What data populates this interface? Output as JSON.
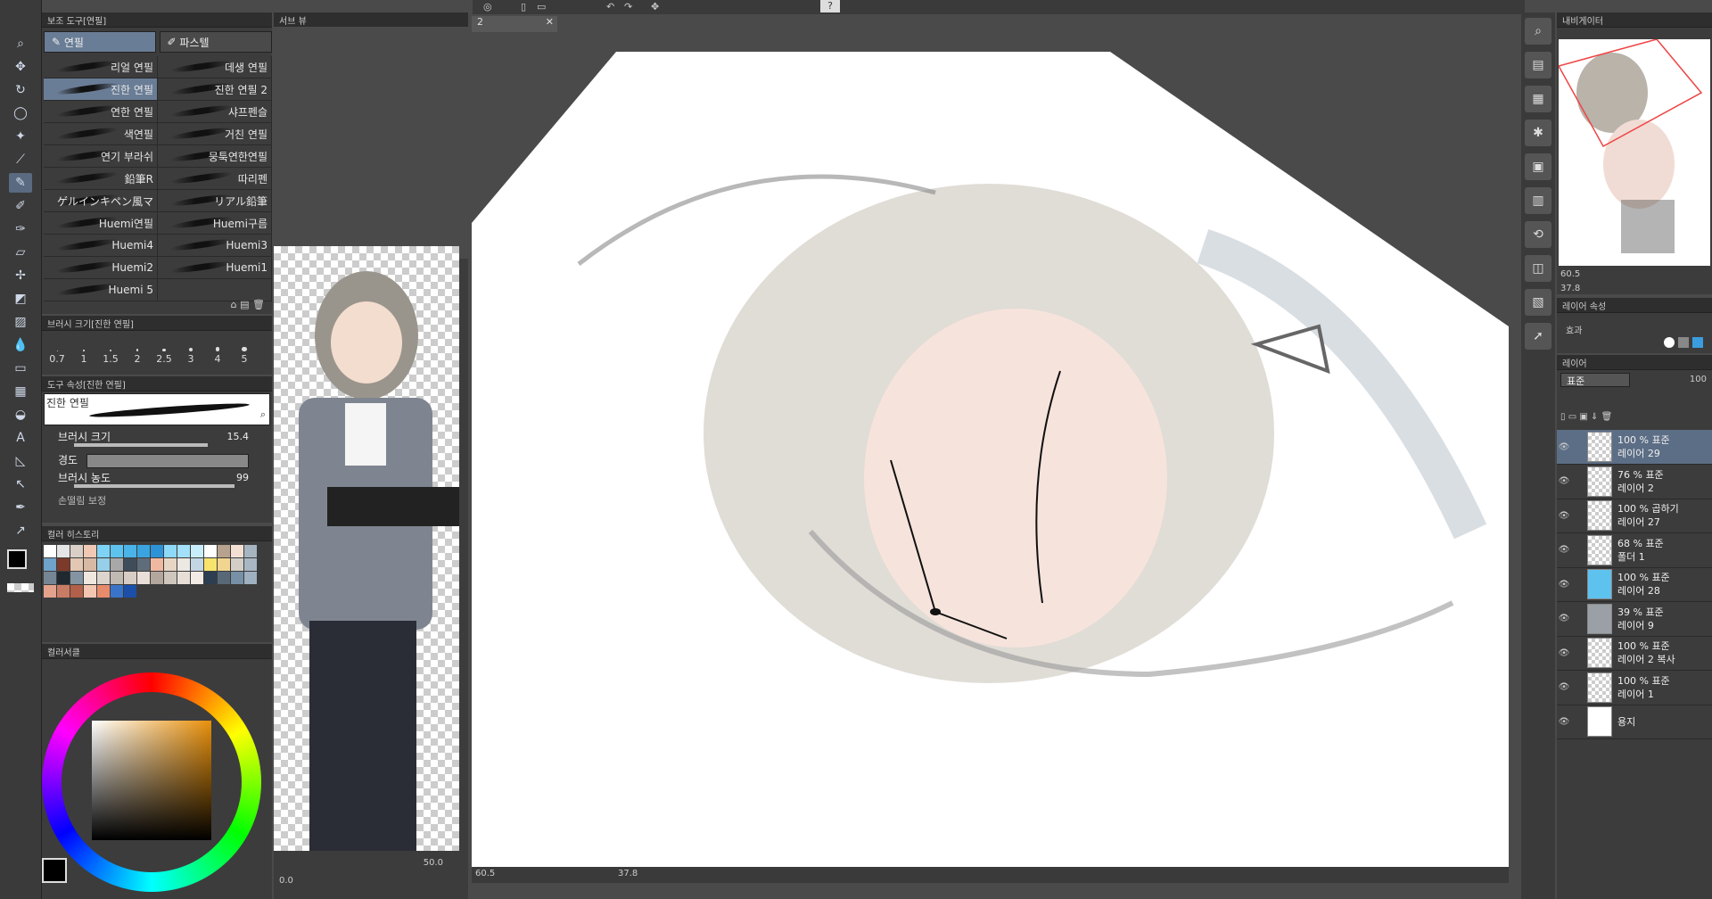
{
  "toolbar": {
    "canvas_tab": "2"
  },
  "subtool_panel": {
    "title": "보조 도구[연필]",
    "tabs": [
      {
        "label": "연필"
      },
      {
        "label": "파스텔"
      }
    ],
    "brushes": [
      [
        "리얼 연필",
        "데생 연필"
      ],
      [
        "진한 연필",
        "진한 연필 2"
      ],
      [
        "연한 연필",
        "샤프펜슬"
      ],
      [
        "색연필",
        "거친 연필"
      ],
      [
        "연기 부라쉬",
        "뭉툭연한연필"
      ],
      [
        "鉛筆R",
        "따리펜"
      ],
      [
        "ゲルインキペン風マ",
        "リアル鉛筆"
      ],
      [
        "Huemi연필",
        "Huemi구름"
      ],
      [
        "Huemi4",
        "Huemi3"
      ],
      [
        "Huemi2",
        "Huemi1"
      ],
      [
        "Huemi 5",
        ""
      ]
    ]
  },
  "brush_size_panel": {
    "title": "브러시 크기[진한 연필]",
    "sizes": [
      "0.7",
      "1",
      "1.5",
      "2",
      "2.5",
      "3",
      "4",
      "5"
    ]
  },
  "tool_property": {
    "title": "도구 속성[진한 연필]",
    "brush_name": "진한 연필",
    "size_label": "브러시 크기",
    "size_value": "15.4",
    "hardness_label": "경도",
    "density_label": "브러시 농도",
    "density_value": "99",
    "cut_label": "손떨림 보정"
  },
  "color_history": {
    "title": "컬러 히스토리"
  },
  "color_circle": {
    "title": "컬러서클"
  },
  "sub_view": {
    "title": "서브 뷰"
  },
  "navigator": {
    "title": "내비게이터",
    "zoom": "60.5",
    "angle": "37.8"
  },
  "layer_property": {
    "title": "레이어 속성",
    "effect_label": "효과"
  },
  "layers_panel": {
    "title": "레이어",
    "blend_mode": "표준",
    "opacity": "100",
    "layers": [
      {
        "mode": "100 % 표준",
        "name": "레이어 29",
        "selected": true
      },
      {
        "mode": "76 % 표준",
        "name": "레이어 2",
        "selected": false
      },
      {
        "mode": "100 % 곱하기",
        "name": "레이어 27",
        "selected": false
      },
      {
        "mode": "68 % 표준",
        "name": "폴더 1",
        "selected": false
      },
      {
        "mode": "100 % 표준",
        "name": "레이어 28",
        "selected": false
      },
      {
        "mode": "39 % 표준",
        "name": "레이어 9",
        "selected": false
      },
      {
        "mode": "100 % 표준",
        "name": "레이어 2 복사",
        "selected": false
      },
      {
        "mode": "100 % 표준",
        "name": "레이어 1",
        "selected": false
      },
      {
        "mode": "",
        "name": "용지",
        "selected": false
      }
    ]
  },
  "status_bar": {
    "zoom": "60.5",
    "angle": "37.8"
  },
  "sub_view_status": {
    "zoom": "50.0",
    "angle": "0.0"
  },
  "colors": {
    "panel_bg": "#3c3c3c",
    "selected_item": "#6a7d96",
    "canvas_bg": "#ffffff"
  }
}
